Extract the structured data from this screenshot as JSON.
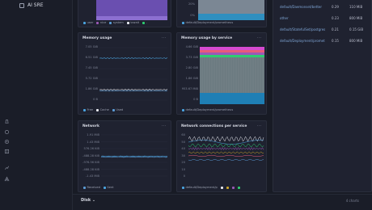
{
  "app": {
    "title": "AI SRE"
  },
  "sidebar": {
    "icons": [
      "bell-icon",
      "chat-icon",
      "settings-icon",
      "grid-icon",
      "chart-icon",
      "logo-icon"
    ]
  },
  "top": {
    "cpu_legend": [
      "user",
      "nice",
      "system",
      "iowait",
      "."
    ],
    "mem_top_axis": [
      "0%",
      "20%"
    ],
    "mem_top_legend": "default/Deployment/prometheus"
  },
  "table": {
    "rows": [
      {
        "name": "default/Daemonset/better",
        "pct": "0.29",
        "value": "110 MiB"
      },
      {
        "name": "other",
        "pct": "0.23",
        "value": "800 MiB"
      },
      {
        "name": "default/StatefulSet/postgres",
        "pct": "0.21",
        "value": "0.15 GiB"
      },
      {
        "name": "default/Deployment/promet",
        "pct": "0.15",
        "value": "800 MiB"
      }
    ]
  },
  "memory_usage": {
    "title": "Memory usage",
    "menu": "...",
    "yticks": [
      "7.05 GiB",
      "6.51 GiB",
      "7.45 GiB",
      "5.72 GiB",
      "1.86 GiB",
      "0 B"
    ],
    "legend": [
      {
        "label": "Free",
        "color": "#4aa3df"
      },
      {
        "label": "Cache",
        "color": "#e7e9f0"
      },
      {
        "label": "Used",
        "color": "#5b9bd5"
      }
    ]
  },
  "memory_by_service": {
    "title": "Memory usage by service",
    "menu": "...",
    "yticks": [
      "4.66 GiB",
      "3.73 GiB",
      "2.80 GiB",
      "1.86 GiB",
      "953.67 MiB",
      "0 B"
    ],
    "legend": [
      {
        "label": "default/Deployment/prometheus",
        "color": "#4aa3df"
      }
    ]
  },
  "network": {
    "title": "Network",
    "menu": "...",
    "yticks": [
      "1.91 MiB",
      "1.43 MiB",
      "576.26 KiB",
      "-488.28 KiB",
      "-976.56 KiB",
      "-488.28 KiB",
      "-1.43 MiB"
    ],
    "legend": [
      {
        "label": "Received",
        "color": "#5b9bd5"
      },
      {
        "label": "Sent",
        "color": "#4aa3df"
      }
    ]
  },
  "net_conns": {
    "title": "Network connections per service",
    "menu": "...",
    "yticks": [
      "60",
      "50",
      "40",
      "30",
      "20",
      "10",
      "0"
    ],
    "legend": [
      {
        "label": "default/Deployment/p",
        "color": "#4aa3df"
      },
      {
        "label": "",
        "color": "#e7e9f0"
      },
      {
        "label": "",
        "color": "#c9a227"
      },
      {
        "label": "",
        "color": "#9b59b6"
      },
      {
        "label": "",
        "color": "#2ecc71"
      }
    ]
  },
  "footer": {
    "section": "Disk",
    "count": "4 charts"
  }
}
